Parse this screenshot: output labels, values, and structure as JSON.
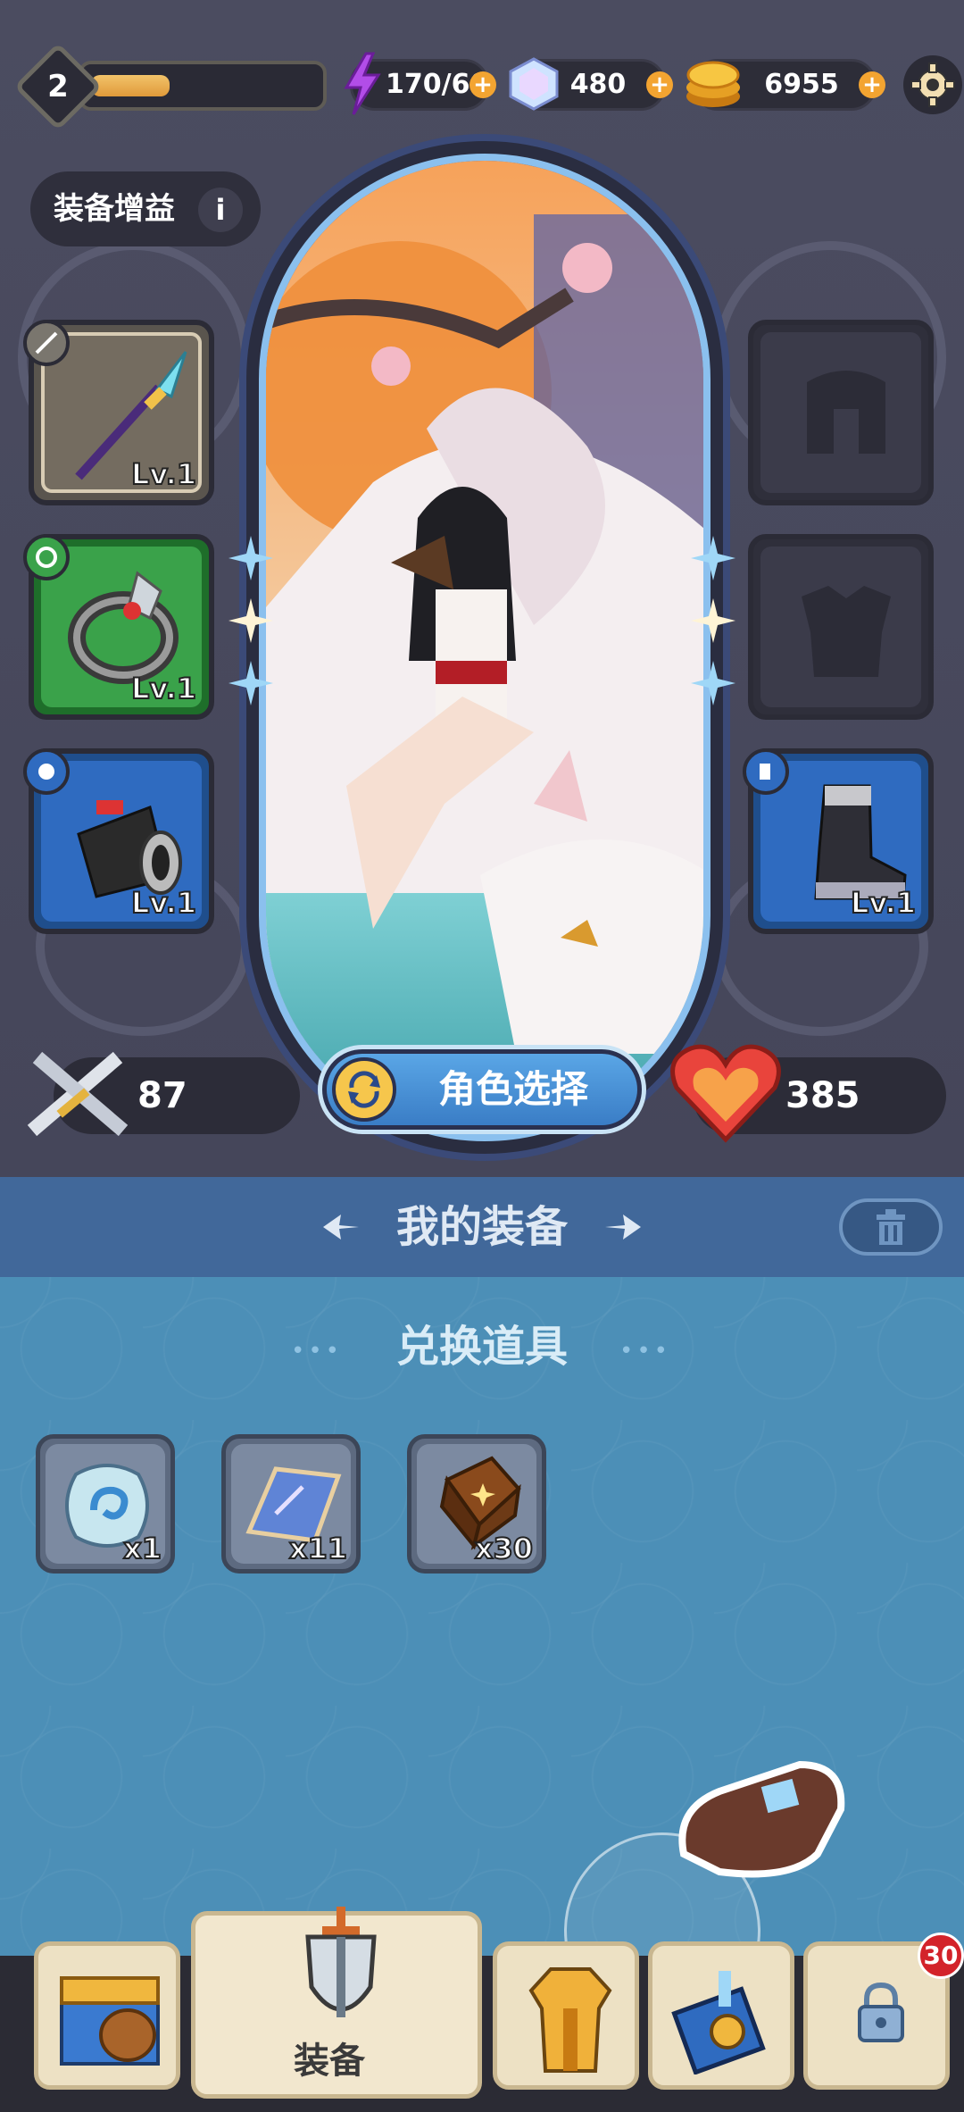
{
  "header": {
    "level": "2",
    "xp_fraction": 0.35,
    "energy": "170/60",
    "gems": "480",
    "coins": "6955",
    "plus": "+"
  },
  "equip_bonus": {
    "label": "装备增益",
    "info": "i"
  },
  "slots": {
    "weapon_lv": "Lv.1",
    "ring_lv": "Lv.1",
    "bracer_lv": "Lv.1",
    "boots_lv": "Lv.1"
  },
  "stats": {
    "attack": "87",
    "health": "385"
  },
  "character_select": {
    "label": "角色选择"
  },
  "my_equipment": {
    "title": "我的装备"
  },
  "exchange": {
    "title": "兑换道具",
    "dots": "•••",
    "items": [
      {
        "count": "x1"
      },
      {
        "count": "x11"
      },
      {
        "count": "x30"
      }
    ]
  },
  "nav": {
    "active_label": "装备",
    "badge": "30"
  },
  "colors": {
    "accent_orange": "#f3a431",
    "ring_green": "#3aa24a",
    "slot_blue": "#2f6bc0",
    "band_blue": "#41689a"
  }
}
